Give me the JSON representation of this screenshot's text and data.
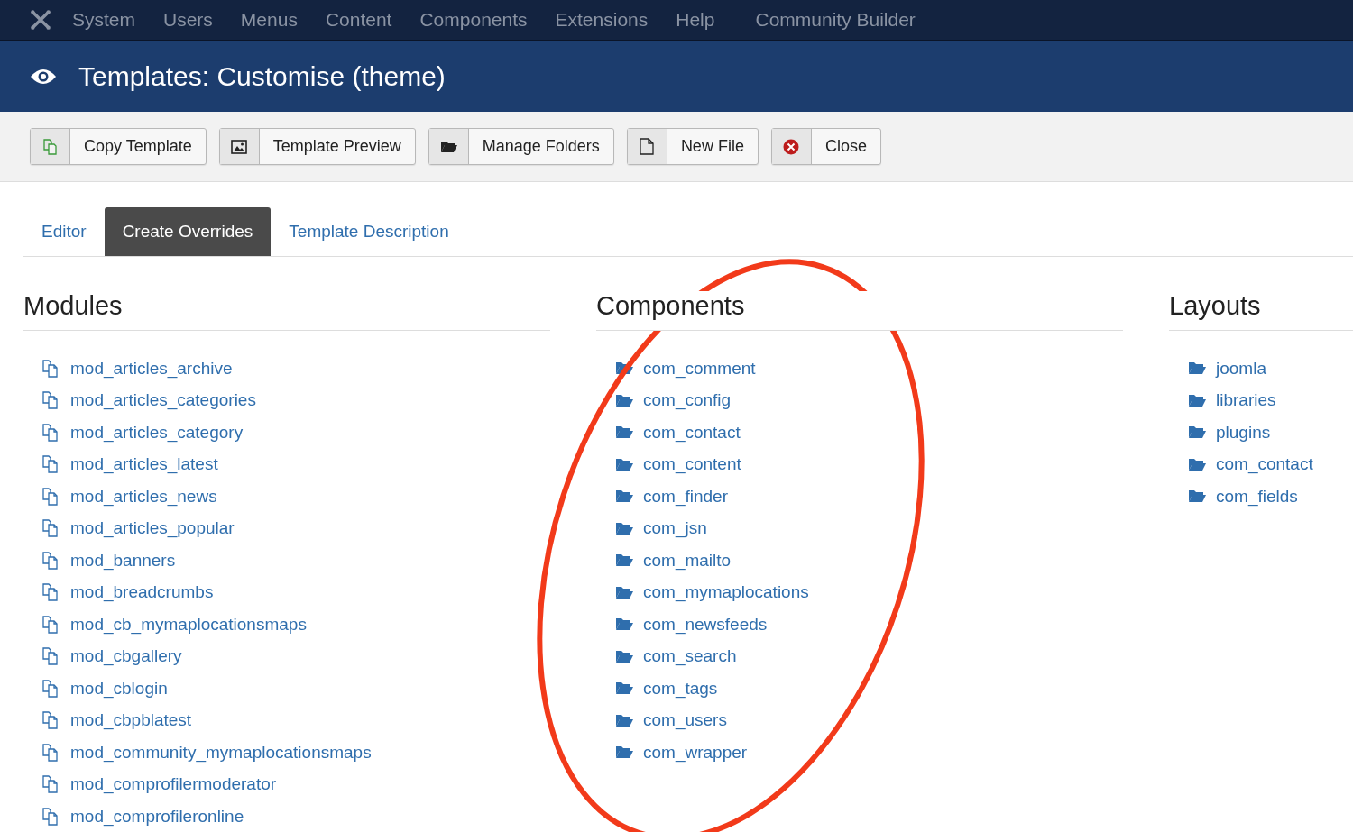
{
  "navbar": {
    "items": [
      "System",
      "Users",
      "Menus",
      "Content",
      "Components",
      "Extensions",
      "Help",
      "Community Builder"
    ]
  },
  "header": {
    "title": "Templates: Customise (theme)"
  },
  "toolbar": [
    {
      "kind": "copy",
      "label": "Copy Template"
    },
    {
      "kind": "image",
      "label": "Template Preview"
    },
    {
      "kind": "folder",
      "label": "Manage Folders"
    },
    {
      "kind": "file",
      "label": "New File"
    },
    {
      "kind": "close",
      "label": "Close"
    }
  ],
  "tabs": [
    {
      "label": "Editor",
      "selected": false
    },
    {
      "label": "Create Overrides",
      "selected": true
    },
    {
      "label": "Template Description",
      "selected": false
    }
  ],
  "columns": [
    {
      "title": "Modules",
      "kind": "file",
      "items": [
        "mod_articles_archive",
        "mod_articles_categories",
        "mod_articles_category",
        "mod_articles_latest",
        "mod_articles_news",
        "mod_articles_popular",
        "mod_banners",
        "mod_breadcrumbs",
        "mod_cb_mymaplocationsmaps",
        "mod_cbgallery",
        "mod_cblogin",
        "mod_cbpblatest",
        "mod_community_mymaplocationsmaps",
        "mod_comprofilermoderator",
        "mod_comprofileronline"
      ]
    },
    {
      "title": "Components",
      "kind": "folder",
      "items": [
        "com_comment",
        "com_config",
        "com_contact",
        "com_content",
        "com_finder",
        "com_jsn",
        "com_mailto",
        "com_mymaplocations",
        "com_newsfeeds",
        "com_search",
        "com_tags",
        "com_users",
        "com_wrapper"
      ]
    },
    {
      "title": "Layouts",
      "kind": "folder",
      "items": [
        "joomla",
        "libraries",
        "plugins",
        "com_contact",
        "com_fields"
      ]
    }
  ]
}
